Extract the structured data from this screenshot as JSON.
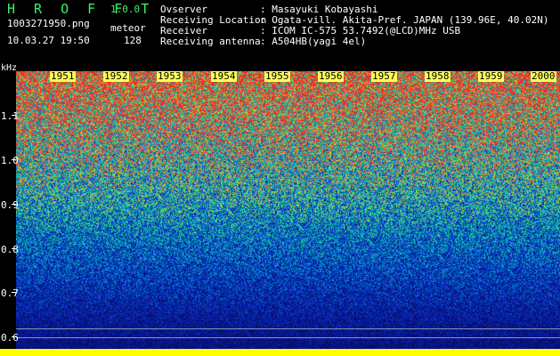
{
  "app": {
    "title": "H R O F F T",
    "version": "1.0.0"
  },
  "file": {
    "name": "1003271950.png",
    "datetime": "10.03.27 19:50"
  },
  "meteor": {
    "label": "meteor",
    "count": "128"
  },
  "info": {
    "observer_label": "Ovserver",
    "observer_value": ": Masayuki Kobayashi",
    "location_label": "Receiving Location",
    "location_value": ": Ogata-vill. Akita-Pref. JAPAN (139.96E, 40.02N)",
    "receiver_label": "Receiver",
    "receiver_value": ": ICOM IC-575 53.7492(@LCD)MHz USB",
    "antenna_label": "Receiving antenna",
    "antenna_value": ": A504HB(yagi 4el)"
  },
  "y_axis": {
    "unit": "kHz",
    "ticks": [
      "1.1",
      "1.0",
      "0.9",
      "0.8",
      "0.7",
      "0.6"
    ]
  },
  "time_axis": {
    "labels": [
      "1951",
      "1952",
      "1953",
      "1954",
      "1955",
      "1956",
      "1957",
      "1958",
      "1959",
      "2000"
    ]
  },
  "colors": {
    "title_green": "#3df26b",
    "time_label_bg": "#ffff55",
    "bottom_bar": "#ffff00",
    "noise_low": "#0a1a8a",
    "noise_mid": "#00c8c8",
    "noise_high": "#ff3030"
  }
}
